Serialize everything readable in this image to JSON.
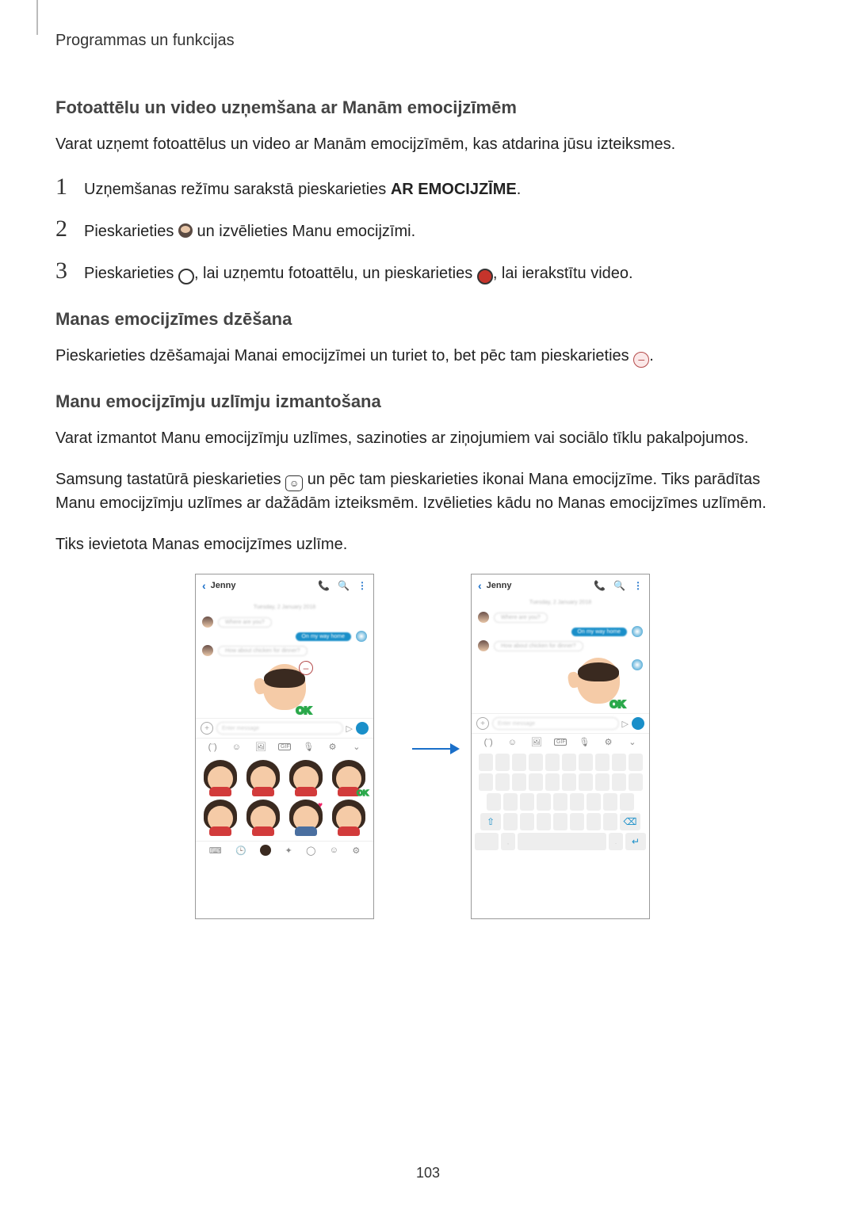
{
  "header": "Programmas un funkcijas",
  "section1": {
    "title": "Fotoattēlu un video uzņemšana ar Manām emocijzīmēm",
    "intro": "Varat uzņemt fotoattēlus un video ar Manām emocijzīmēm, kas atdarina jūsu izteiksmes.",
    "step1_a": "Uzņemšanas režīmu sarakstā pieskarieties ",
    "step1_b": "AR EMOCIJZĪME",
    "step1_c": ".",
    "step2_a": "Pieskarieties ",
    "step2_b": " un izvēlieties Manu emocijzīmi.",
    "step3_a": "Pieskarieties ",
    "step3_b": ", lai uzņemtu fotoattēlu, un pieskarieties ",
    "step3_c": ", lai ierakstītu video."
  },
  "nums": {
    "n1": "1",
    "n2": "2",
    "n3": "3"
  },
  "section2": {
    "title": "Manas emocijzīmes dzēšana",
    "body_a": "Pieskarieties dzēšamajai Manai emocijzīmei un turiet to, bet pēc tam pieskarieties ",
    "body_b": "."
  },
  "section3": {
    "title": "Manu emocijzīmju uzlīmju izmantošana",
    "p1": "Varat izmantot Manu emocijzīmju uzlīmes, sazinoties ar ziņojumiem vai sociālo tīklu pakalpojumos.",
    "p2_a": "Samsung tastatūrā pieskarieties ",
    "p2_b": " un pēc tam pieskarieties ikonai Mana emocijzīme. Tiks parādītas Manu emocijzīmju uzlīmes ar dažādām izteiksmēm. Izvēlieties kādu no Manas emocijzīmes uzlīmēm.",
    "p3": "Tiks ievietota Manas emocijzīmes uzlīme."
  },
  "phone": {
    "contact": "Jenny",
    "date_blur": "Tuesday, 2 January 2018",
    "msg1": "Where are you?",
    "msg2_blur": "On my way home",
    "msg3": "How about chicken for dinner?",
    "input_ph": "Enter message",
    "ok": "OK",
    "minus": "–"
  },
  "glyphs": {
    "back": "‹",
    "phone": "📞",
    "search": "🔍",
    "more": "⋮",
    "plus": "+",
    "send": "▷",
    "tab_brace": "(¨)",
    "smile": "☺",
    "sticker": "🖼",
    "gif": "GIF",
    "mic": "🎙",
    "gear": "⚙",
    "chev": "⌄",
    "kbd": "⌨",
    "clock": "🕒",
    "star": "✦",
    "shift": "⇧",
    "bksp": "⌫",
    "enter": "↵",
    "face": "☻",
    "dot": "."
  },
  "pageNumber": "103"
}
